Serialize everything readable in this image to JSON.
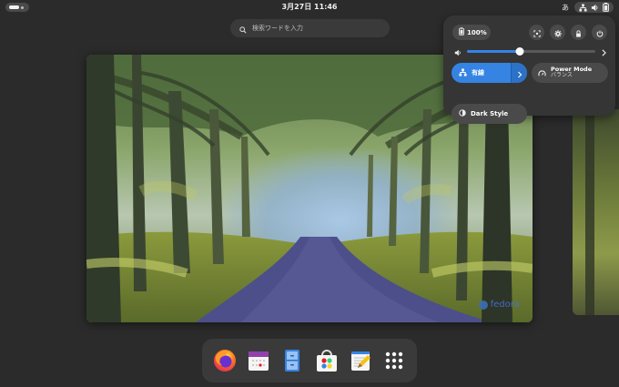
{
  "topbar": {
    "clock": "3月27日  11:46",
    "input_method": "あ"
  },
  "search": {
    "placeholder": "検索ワードを入力"
  },
  "workspace": {
    "watermark": "fedora"
  },
  "quick_settings": {
    "battery_label": "100%",
    "volume_level": 0.41,
    "wired_label": "有線",
    "power_mode_title": "Power Mode",
    "power_mode_value": "バランス",
    "dark_style_label": "Dark Style"
  },
  "dash": {
    "apps": [
      "firefox-icon",
      "calendar-icon",
      "files-icon",
      "software-icon",
      "text-editor-icon",
      "app-grid-icon"
    ]
  },
  "colors": {
    "accent": "#3584e4",
    "panel": "#353535",
    "background": "#2b2b2b"
  }
}
